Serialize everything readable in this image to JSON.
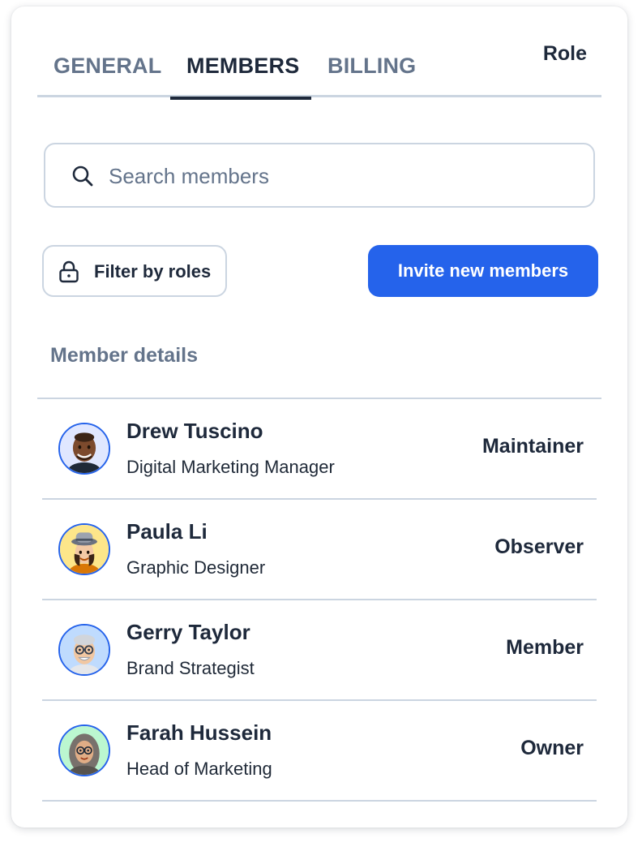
{
  "tabs": [
    {
      "label": "GENERAL"
    },
    {
      "label": "MEMBERS"
    },
    {
      "label": "BILLING"
    }
  ],
  "active_tab": "MEMBERS",
  "search": {
    "placeholder": "Search members",
    "value": ""
  },
  "buttons": {
    "filter_label": "Filter by roles",
    "invite_label": "Invite new members"
  },
  "table": {
    "headers": {
      "details": "Member details",
      "role": "Role"
    },
    "members": [
      {
        "name": "Drew Tuscino",
        "title": "Digital Marketing Manager",
        "role": "Maintainer",
        "avatar_bg": "#e0e7ff"
      },
      {
        "name": "Paula Li",
        "title": "Graphic Designer",
        "role": "Observer",
        "avatar_bg": "#fde68a"
      },
      {
        "name": "Gerry Taylor",
        "title": "Brand Strategist",
        "role": "Member",
        "avatar_bg": "#bfdbfe"
      },
      {
        "name": "Farah Hussein",
        "title": "Head of Marketing",
        "role": "Owner",
        "avatar_bg": "#bbf7d0"
      }
    ]
  },
  "colors": {
    "accent": "#2563eb",
    "text_dark": "#1e293b",
    "text_muted": "#64748b",
    "border": "#cbd5e1"
  }
}
